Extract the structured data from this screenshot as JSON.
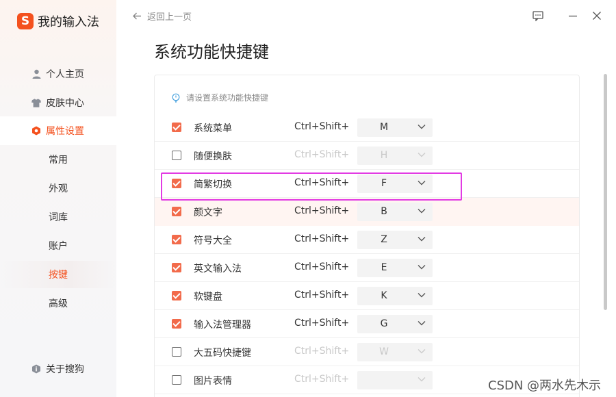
{
  "brand": {
    "logo_glyph": "S",
    "name": "我的输入法",
    "accent": "#f4511e"
  },
  "nav": {
    "home": "个人主页",
    "skins": "皮肤中心",
    "settings": "属性设置",
    "sub": [
      "常用",
      "外观",
      "词库",
      "账户",
      "按键",
      "高级"
    ],
    "active_sub": "按键",
    "about": "关于搜狗"
  },
  "topbar": {
    "back_label": "返回上一页"
  },
  "page": {
    "title": "系统功能快捷键",
    "hint": "请设置系统功能快捷键"
  },
  "shortcuts": [
    {
      "label": "系统菜单",
      "enabled": true,
      "modifier": "Ctrl+Shift+",
      "key": "M"
    },
    {
      "label": "随便换肤",
      "enabled": false,
      "modifier": "Ctrl+Shift+",
      "key": "H"
    },
    {
      "label": "简繁切换",
      "enabled": true,
      "modifier": "Ctrl+Shift+",
      "key": "F"
    },
    {
      "label": "颜文字",
      "enabled": true,
      "modifier": "Ctrl+Shift+",
      "key": "B"
    },
    {
      "label": "符号大全",
      "enabled": true,
      "modifier": "Ctrl+Shift+",
      "key": "Z"
    },
    {
      "label": "英文输入法",
      "enabled": true,
      "modifier": "Ctrl+Shift+",
      "key": "E"
    },
    {
      "label": "软键盘",
      "enabled": true,
      "modifier": "Ctrl+Shift+",
      "key": "K"
    },
    {
      "label": "输入法管理器",
      "enabled": true,
      "modifier": "Ctrl+Shift+",
      "key": "G"
    },
    {
      "label": "大五码快捷键",
      "enabled": false,
      "modifier": "Ctrl+Shift+",
      "key": "W"
    },
    {
      "label": "图片表情",
      "enabled": false,
      "modifier": "Ctrl+Shift+",
      "key": ""
    }
  ],
  "watermark": "CSDN @两水先木示"
}
